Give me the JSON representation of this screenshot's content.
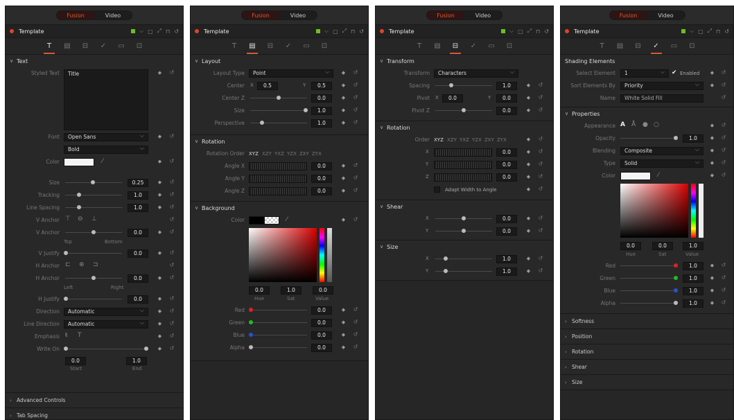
{
  "common": {
    "mode_tabs": [
      "Fusion",
      "Video"
    ],
    "template_title": "Template",
    "tab_icons": [
      "text-tab-icon",
      "layout-tab-icon",
      "transform-tab-icon",
      "shading-tab-icon",
      "image-tab-icon",
      "settings-tab-icon"
    ],
    "accent": "#e05a2a"
  },
  "p1": {
    "text_section": "Text",
    "styled_text_label": "Styled Text",
    "styled_text_value": "Title",
    "font_label": "Font",
    "font_value": "Open Sans",
    "style_value": "Bold",
    "color_label": "Color",
    "size_label": "Size",
    "size_value": "0.25",
    "tracking_label": "Tracking",
    "tracking_value": "1.0",
    "line_spacing_label": "Line Spacing",
    "line_spacing_value": "1.0",
    "vanchor_label": "V Anchor",
    "vanchor2_label": "V Anchor",
    "vanchor2_value": "0.0",
    "top_label": "Top",
    "bottom_label": "Bottom",
    "vjustify_label": "V Justify",
    "vjustify_value": "0.0",
    "hanchor_label": "H Anchor",
    "hanchor2_label": "H Anchor",
    "hanchor2_value": "0.0",
    "left_label": "Left",
    "right_label": "Right",
    "hjustify_label": "H Justify",
    "hjustify_value": "0.0",
    "direction_label": "Direction",
    "direction_value": "Automatic",
    "line_direction_label": "Line Direction",
    "line_direction_value": "Automatic",
    "emphasis_label": "Emphasis",
    "write_on_label": "Write On",
    "start_value": "0.0",
    "end_value": "1.0",
    "start_label": "Start",
    "end_label": "End",
    "advanced": "Advanced Controls",
    "tab_spacing": "Tab Spacing"
  },
  "p2": {
    "layout_section": "Layout",
    "layout_type_label": "Layout Type",
    "layout_type_value": "Point",
    "center_label": "Center",
    "center_x": "0.5",
    "center_y": "0.5",
    "centerz_label": "Center Z",
    "centerz_value": "0.0",
    "size_label": "Size",
    "size_value": "1.0",
    "perspective_label": "Perspective",
    "perspective_value": "1.0",
    "rotation_section": "Rotation",
    "rotation_order_label": "Rotation Order",
    "orders": [
      "XYZ",
      "XZY",
      "YXZ",
      "YZX",
      "ZXY",
      "ZYX"
    ],
    "anglex_label": "Angle X",
    "anglex_value": "0.0",
    "angley_label": "Angle Y",
    "angley_value": "0.0",
    "anglez_label": "Angle Z",
    "anglez_value": "0.0",
    "background_section": "Background",
    "color_label": "Color",
    "hue_value": "0.0",
    "sat_value": "1.0",
    "val_value": "0.0",
    "hue_label": "Hue",
    "sat_label": "Sat",
    "val_label": "Value",
    "red_label": "Red",
    "red_value": "0.0",
    "green_label": "Green",
    "green_value": "0.0",
    "blue_label": "Blue",
    "blue_value": "0.0",
    "alpha_label": "Alpha",
    "alpha_value": "0.0"
  },
  "p3": {
    "transform_section": "Transform",
    "transform_label": "Transform",
    "transform_value": "Characters",
    "spacing_label": "Spacing",
    "spacing_value": "1.0",
    "pivot_label": "Pivot",
    "pivot_x": "0.0",
    "pivot_y": "0.0",
    "pivotz_label": "Pivot Z",
    "pivotz_value": "0.0",
    "rotation_section": "Rotation",
    "order_label": "Order",
    "orders": [
      "XYZ",
      "XZY",
      "YXZ",
      "YZX",
      "ZXY",
      "ZYX"
    ],
    "x_value": "0.0",
    "y_value": "0.0",
    "z_value": "0.0",
    "adapt_label": "Adapt Width to Angle",
    "shear_section": "Shear",
    "shear_x_value": "0.0",
    "shear_y_value": "0.0",
    "size_section": "Size",
    "size_x_value": "1.0",
    "size_y_value": "1.0"
  },
  "p4": {
    "shading_section": "Shading Elements",
    "select_label": "Select Element",
    "select_value": "1",
    "enabled_label": "Enabled",
    "sort_label": "Sort Elements By",
    "sort_value": "Priority",
    "name_label": "Name",
    "name_value": "White Solid Fill",
    "properties_section": "Properties",
    "appearance_label": "Appearance",
    "opacity_label": "Opacity",
    "opacity_value": "1.0",
    "blending_label": "Blending",
    "blending_value": "Composite",
    "type_label": "Type",
    "type_value": "Solid",
    "color_label": "Color",
    "hue_value": "0.0",
    "sat_value": "0.0",
    "val_value": "1.0",
    "hue_label": "Hue",
    "sat_label": "Sat",
    "val_label": "Value",
    "red_label": "Red",
    "red_value": "1.0",
    "green_label": "Green",
    "green_value": "1.0",
    "blue_label": "Blue",
    "blue_value": "1.0",
    "alpha_label": "Alpha",
    "alpha_value": "1.0",
    "collapsed": [
      "Softness",
      "Position",
      "Rotation",
      "Shear",
      "Size"
    ]
  }
}
